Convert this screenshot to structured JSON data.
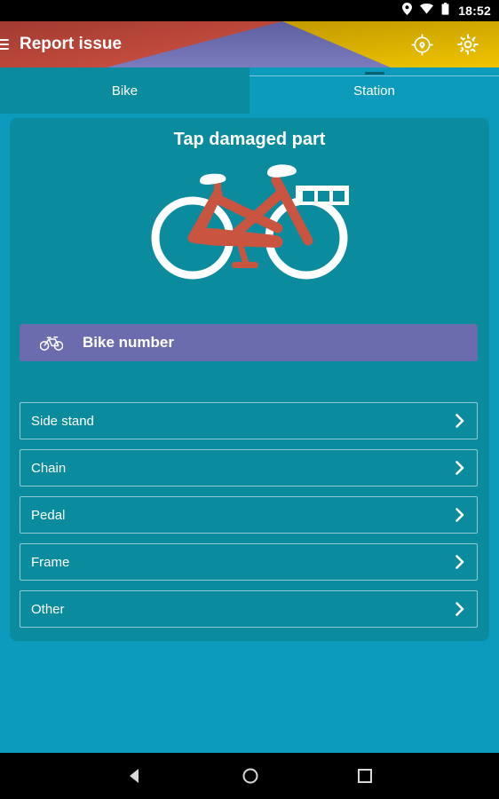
{
  "statusbar": {
    "time": "18:52",
    "icons": [
      "location-pin-icon",
      "wifi-icon",
      "battery-icon"
    ]
  },
  "appbar": {
    "menu_icon": "hamburger-menu-icon",
    "title": "Report issue",
    "actions": [
      {
        "name": "locate-icon",
        "label": "Locate"
      },
      {
        "name": "settings-gear-icon",
        "label": "Settings"
      }
    ],
    "colors": {
      "red": "#c0392b",
      "yellow": "#d4aa00",
      "purple": "#6b6cae"
    }
  },
  "tabs": [
    {
      "label": "Bike",
      "active": true
    },
    {
      "label": "Station",
      "active": false
    }
  ],
  "main": {
    "title": "Tap damaged part",
    "illustration": "bicycle-illustration",
    "bike_number": {
      "label": "Bike number",
      "icon": "bicycle-icon",
      "color": "#6b6cae"
    },
    "parts": [
      {
        "label": "Side stand"
      },
      {
        "label": "Chain"
      },
      {
        "label": "Pedal"
      },
      {
        "label": "Frame"
      },
      {
        "label": "Other"
      }
    ]
  },
  "navbar": {
    "buttons": [
      {
        "name": "back-button",
        "label": "Back"
      },
      {
        "name": "home-button",
        "label": "Home"
      },
      {
        "name": "recents-button",
        "label": "Recents"
      }
    ]
  },
  "theme": {
    "background": "#0c9bbd",
    "card": "#0a8b9e",
    "bike_frame": "#c9543f",
    "accent_white": "#ffffff"
  }
}
